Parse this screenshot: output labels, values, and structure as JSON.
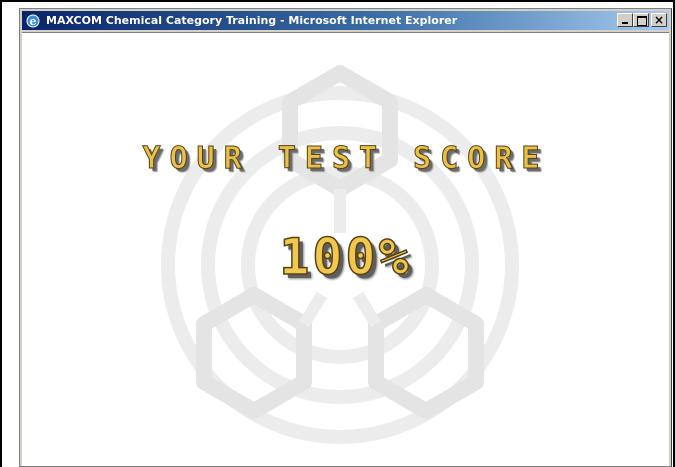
{
  "window": {
    "title": "MAXCOM Chemical Category Training - Microsoft Internet Explorer",
    "icon": "ie-icon",
    "buttons": [
      "minimize",
      "maximize",
      "close"
    ]
  },
  "content": {
    "heading": "YOUR TEST SCORE",
    "score": "100%",
    "watermark": "molecule-logo-watermark",
    "heading_color": "#e8c04a",
    "score_color": "#f0c850"
  }
}
